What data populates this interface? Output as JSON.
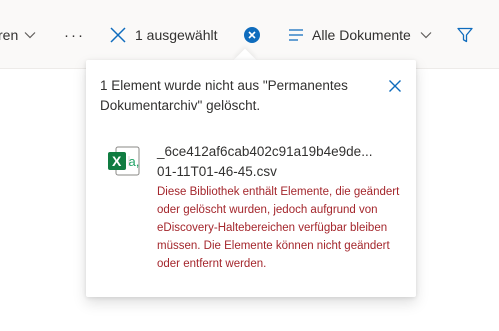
{
  "toolbar": {
    "partial_label": "ren",
    "more_label": "···",
    "selected_label": "1 ausgewählt",
    "view_label": "Alle Dokumente"
  },
  "panel": {
    "message": "1 Element wurde nicht aus \"Permanentes Dokumentarchiv\" gelöscht.",
    "file_name_line1": "_6ce412af6cab402c91a19b4e9de...",
    "file_name_line2": "01-11T01-46-45.csv",
    "note": "Diese Bibliothek enthält Elemente, die geändert oder gelöscht wurden, jedoch aufgrund von eDiscovery-Haltebereichen verfügbar bleiben müssen. Die Elemente können nicht geändert oder entfernt werden."
  },
  "icons": {
    "chevron": "chevron-down-icon",
    "close": "close-icon",
    "clear": "clear-selection-icon",
    "view": "list-view-icon",
    "filter": "filter-icon",
    "file": "excel-file-icon"
  },
  "colors": {
    "accent": "#0f6cbd",
    "error_text": "#a4262c",
    "excel_green": "#107c41"
  }
}
